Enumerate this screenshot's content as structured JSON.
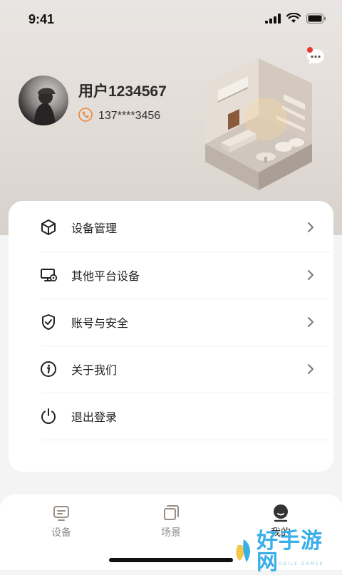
{
  "status_bar": {
    "time": "9:41"
  },
  "profile": {
    "username": "用户1234567",
    "phone": "137****3456"
  },
  "menu": {
    "items": [
      {
        "label": "设备管理",
        "icon": "cube-icon",
        "has_arrow": true
      },
      {
        "label": "其他平台设备",
        "icon": "monitor-gear-icon",
        "has_arrow": true
      },
      {
        "label": "账号与安全",
        "icon": "shield-check-icon",
        "has_arrow": true
      },
      {
        "label": "关于我们",
        "icon": "info-icon",
        "has_arrow": true
      },
      {
        "label": "退出登录",
        "icon": "power-icon",
        "has_arrow": false
      }
    ]
  },
  "tabbar": {
    "tabs": [
      {
        "label": "设备",
        "icon": "device-icon",
        "active": false
      },
      {
        "label": "场景",
        "icon": "scene-icon",
        "active": false
      },
      {
        "label": "我的",
        "icon": "profile-icon",
        "active": true
      }
    ]
  },
  "watermark": {
    "text": "好手游网",
    "subtext": "MOBILE GAMES"
  },
  "colors": {
    "accent_orange": "#e8893a",
    "notification_dot": "#e53935",
    "tab_inactive": "#8f8f8f",
    "tab_active": "#333333",
    "watermark_blue": "#3aaee8"
  }
}
